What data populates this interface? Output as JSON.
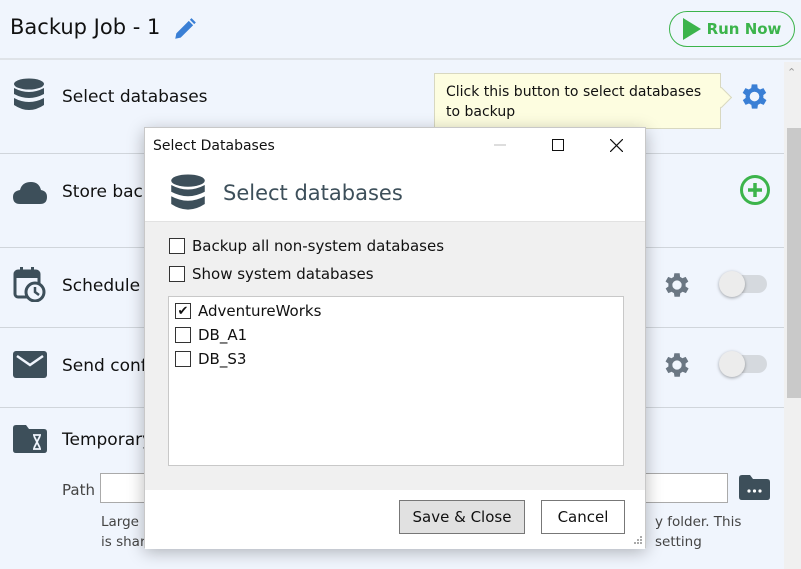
{
  "header": {
    "title": "Backup Job - 1",
    "run_now_label": "Run Now"
  },
  "sections": {
    "select_databases": {
      "label": "Select databases"
    },
    "store_backups": {
      "label": "Store back"
    },
    "schedule": {
      "label": "Schedule b"
    },
    "send_confirmation": {
      "label": "Send confi"
    },
    "temporary": {
      "label": "Temporary"
    }
  },
  "tooltip": {
    "text": "Click this button to select databases to backup"
  },
  "temp_folder": {
    "path_label": "Path",
    "path_value": "",
    "help_text_left": "Large c",
    "help_text_left2": "is share",
    "help_text_right": "y folder. This setting"
  },
  "colors": {
    "accent_green": "#3cb44b",
    "accent_blue": "#3a7fd5",
    "icon_slate": "#3d4f5a"
  },
  "dialog": {
    "window_title": "Select Databases",
    "header_title": "Select databases",
    "options": [
      {
        "label": "Backup all non-system databases",
        "checked": false
      },
      {
        "label": "Show system databases",
        "checked": false
      }
    ],
    "databases": [
      {
        "name": "AdventureWorks",
        "checked": true
      },
      {
        "name": "DB_A1",
        "checked": false
      },
      {
        "name": "DB_S3",
        "checked": false
      }
    ],
    "save_label": "Save & Close",
    "cancel_label": "Cancel",
    "check_glyph": "✔"
  }
}
